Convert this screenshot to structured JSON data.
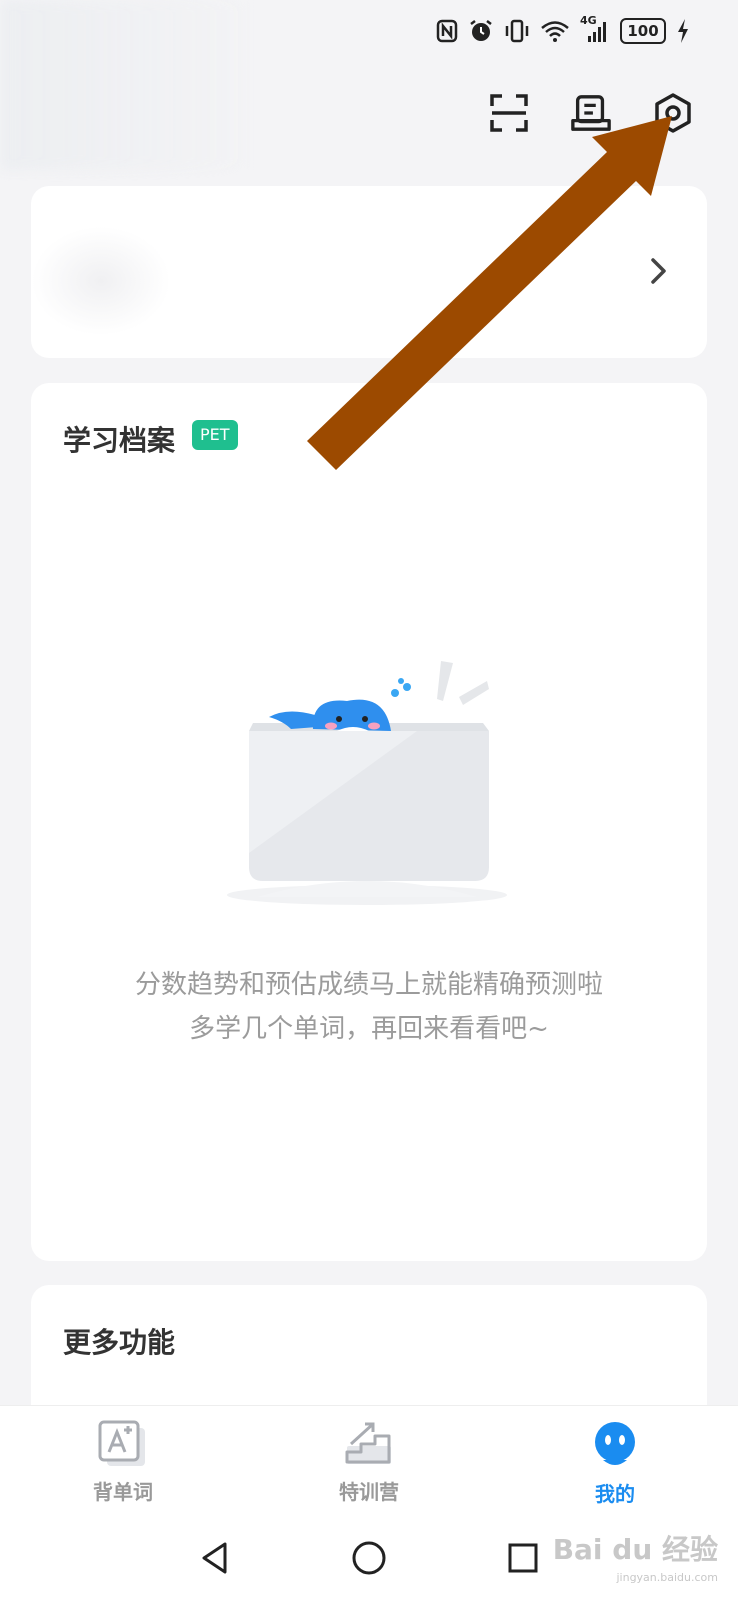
{
  "status_bar": {
    "network": "4G",
    "battery": "100",
    "icons": [
      "nfc-icon",
      "alarm-icon",
      "vibrate-icon",
      "wifi-icon",
      "signal-icon",
      "battery-icon",
      "charging-icon"
    ]
  },
  "header": {
    "actions": [
      "scan-icon",
      "checkin-icon",
      "settings-icon"
    ]
  },
  "profile": {
    "chevron": "chevron-right-icon"
  },
  "study_record": {
    "title": "学习档案",
    "badge": "PET",
    "empty_line1": "分数趋势和预估成绩马上就能精确预测啦",
    "empty_line2": "多学几个单词，再回来看看吧~"
  },
  "more": {
    "title": "更多功能"
  },
  "tabs": [
    {
      "label": "背单词",
      "icon": "word-card-icon",
      "active": false
    },
    {
      "label": "特训营",
      "icon": "stairs-icon",
      "active": false
    },
    {
      "label": "我的",
      "icon": "mascot-icon",
      "active": true
    }
  ],
  "nav": [
    "back-icon",
    "home-icon",
    "recents-icon"
  ],
  "colors": {
    "accent": "#1a8cf0",
    "badge": "#1fbf8f",
    "arrow": "#9c4a00"
  },
  "watermark": {
    "brand": "Bai du 经验",
    "url": "jingyan.baidu.com"
  }
}
